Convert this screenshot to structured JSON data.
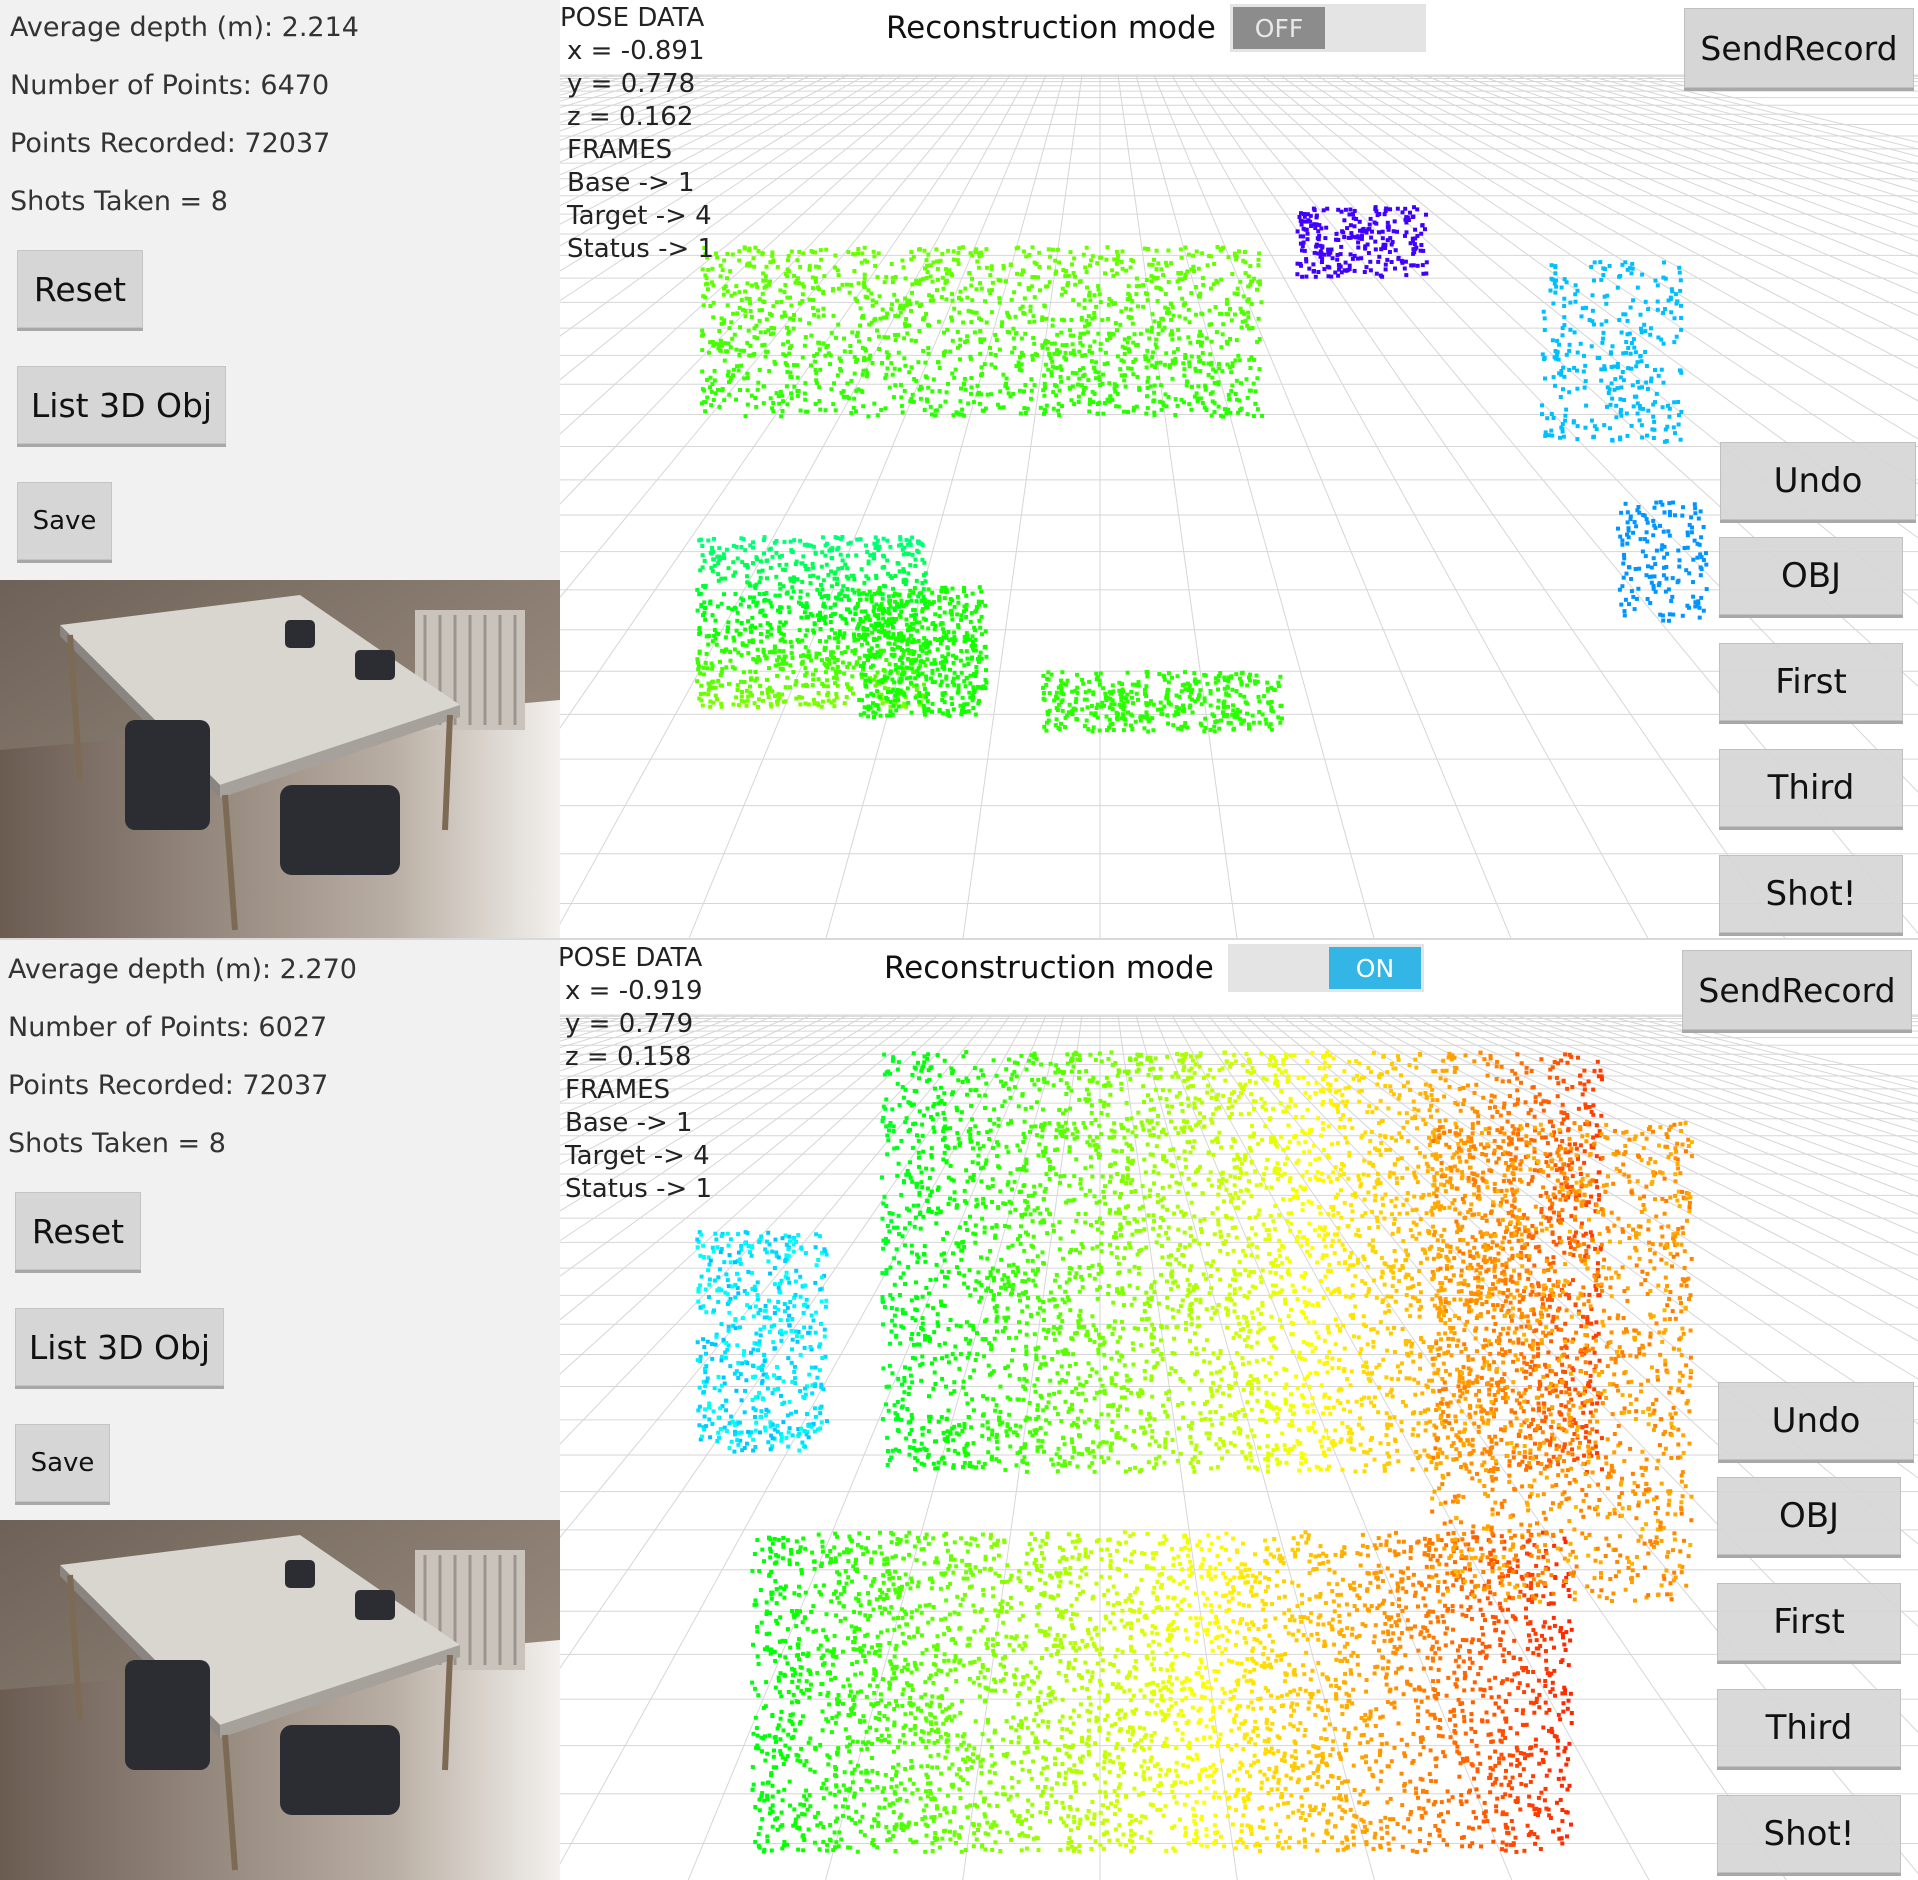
{
  "screens": [
    {
      "stats": {
        "average_depth": "Average depth (m): 2.214",
        "num_points": "Number of Points: 6470",
        "points_recorded": "Points Recorded: 72037",
        "shots_taken": "Shots Taken = 8"
      },
      "buttons": {
        "reset": "Reset",
        "list3d": "List 3D Obj",
        "save": "Save"
      },
      "pose": {
        "title": "POSE DATA",
        "x": "x = -0.891",
        "y": "y = 0.778",
        "z": "z = 0.162",
        "frames": "FRAMES",
        "base": "Base -> 1",
        "target": "Target -> 4",
        "status": "Status -> 1"
      },
      "reconstruction": {
        "label": "Reconstruction mode",
        "toggle_text": "OFF",
        "state": "off"
      },
      "send_record": "SendRecord",
      "side_buttons": [
        "Undo",
        "OBJ",
        "First",
        "Third",
        "Shot!"
      ]
    },
    {
      "stats": {
        "average_depth": "Average depth (m): 2.270",
        "num_points": "Number of Points: 6027",
        "points_recorded": "Points Recorded: 72037",
        "shots_taken": "Shots Taken = 8"
      },
      "buttons": {
        "reset": "Reset",
        "list3d": "List 3D Obj",
        "save": "Save"
      },
      "pose": {
        "title": "POSE DATA",
        "x": "x = -0.919",
        "y": "y = 0.779",
        "z": "z = 0.158",
        "frames": "FRAMES",
        "base": "Base -> 1",
        "target": "Target -> 4",
        "status": "Status -> 1"
      },
      "reconstruction": {
        "label": "Reconstruction mode",
        "toggle_text": "ON",
        "state": "on"
      },
      "send_record": "SendRecord",
      "side_buttons": [
        "Undo",
        "OBJ",
        "First",
        "Third",
        "Shot!"
      ]
    }
  ],
  "colors": {
    "toggle_on": "#33b5e5",
    "toggle_off": "#8c8c8c",
    "button_bg": "#d6d6d6",
    "pane_bg": "#f1f1f1"
  },
  "icons": {
    "point_cloud": "point-cloud-view",
    "camera_preview": "camera-preview-image"
  }
}
